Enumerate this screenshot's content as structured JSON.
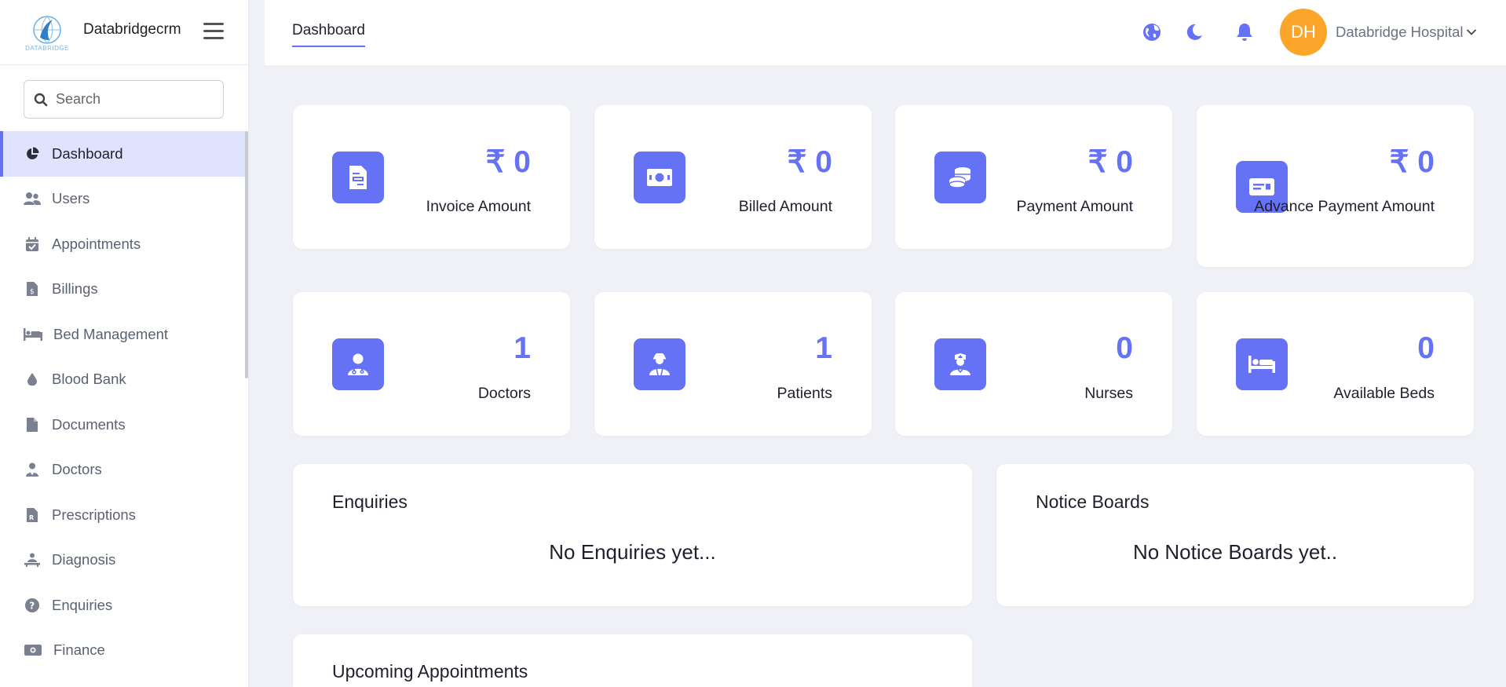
{
  "brand": {
    "name": "Databridgecrm",
    "logo_text": "DATABRIDGE"
  },
  "search": {
    "placeholder": "Search"
  },
  "sidebar": {
    "items": [
      {
        "label": "Dashboard",
        "icon": "pie-chart-icon"
      },
      {
        "label": "Users",
        "icon": "users-icon"
      },
      {
        "label": "Appointments",
        "icon": "calendar-check-icon"
      },
      {
        "label": "Billings",
        "icon": "invoice-dollar-icon"
      },
      {
        "label": "Bed Management",
        "icon": "bed-icon"
      },
      {
        "label": "Blood Bank",
        "icon": "blood-drop-icon"
      },
      {
        "label": "Documents",
        "icon": "file-icon"
      },
      {
        "label": "Doctors",
        "icon": "doctor-icon"
      },
      {
        "label": "Prescriptions",
        "icon": "prescription-icon"
      },
      {
        "label": "Diagnosis",
        "icon": "diagnosis-icon"
      },
      {
        "label": "Enquiries",
        "icon": "question-circle-icon"
      },
      {
        "label": "Finance",
        "icon": "money-bill-icon"
      }
    ]
  },
  "header": {
    "tab": "Dashboard",
    "avatar_initials": "DH",
    "user_name": "Databridge Hospital",
    "avatar_color": "#fba52a"
  },
  "stats_row1": [
    {
      "value": "₹ 0",
      "label": "Invoice Amount",
      "icon": "invoice-icon"
    },
    {
      "value": "₹ 0",
      "label": "Billed Amount",
      "icon": "money-bill-icon"
    },
    {
      "value": "₹ 0",
      "label": "Payment Amount",
      "icon": "coins-icon"
    },
    {
      "value": "₹ 0",
      "label": "Advance Payment Amount",
      "icon": "money-check-icon"
    }
  ],
  "stats_row2": [
    {
      "value": "1",
      "label": "Doctors",
      "icon": "doctor-icon"
    },
    {
      "value": "1",
      "label": "Patients",
      "icon": "patient-icon"
    },
    {
      "value": "0",
      "label": "Nurses",
      "icon": "nurse-icon"
    },
    {
      "value": "0",
      "label": "Available Beds",
      "icon": "bed-icon"
    }
  ],
  "panels": {
    "enquiries": {
      "title": "Enquiries",
      "empty": "No Enquiries yet..."
    },
    "notice_boards": {
      "title": "Notice Boards",
      "empty": "No Notice Boards yet.."
    },
    "upcoming": {
      "title": "Upcoming Appointments"
    }
  },
  "colors": {
    "accent": "#6672f5",
    "active_bg": "#dfe3fd",
    "page_bg": "#eff1f6"
  }
}
